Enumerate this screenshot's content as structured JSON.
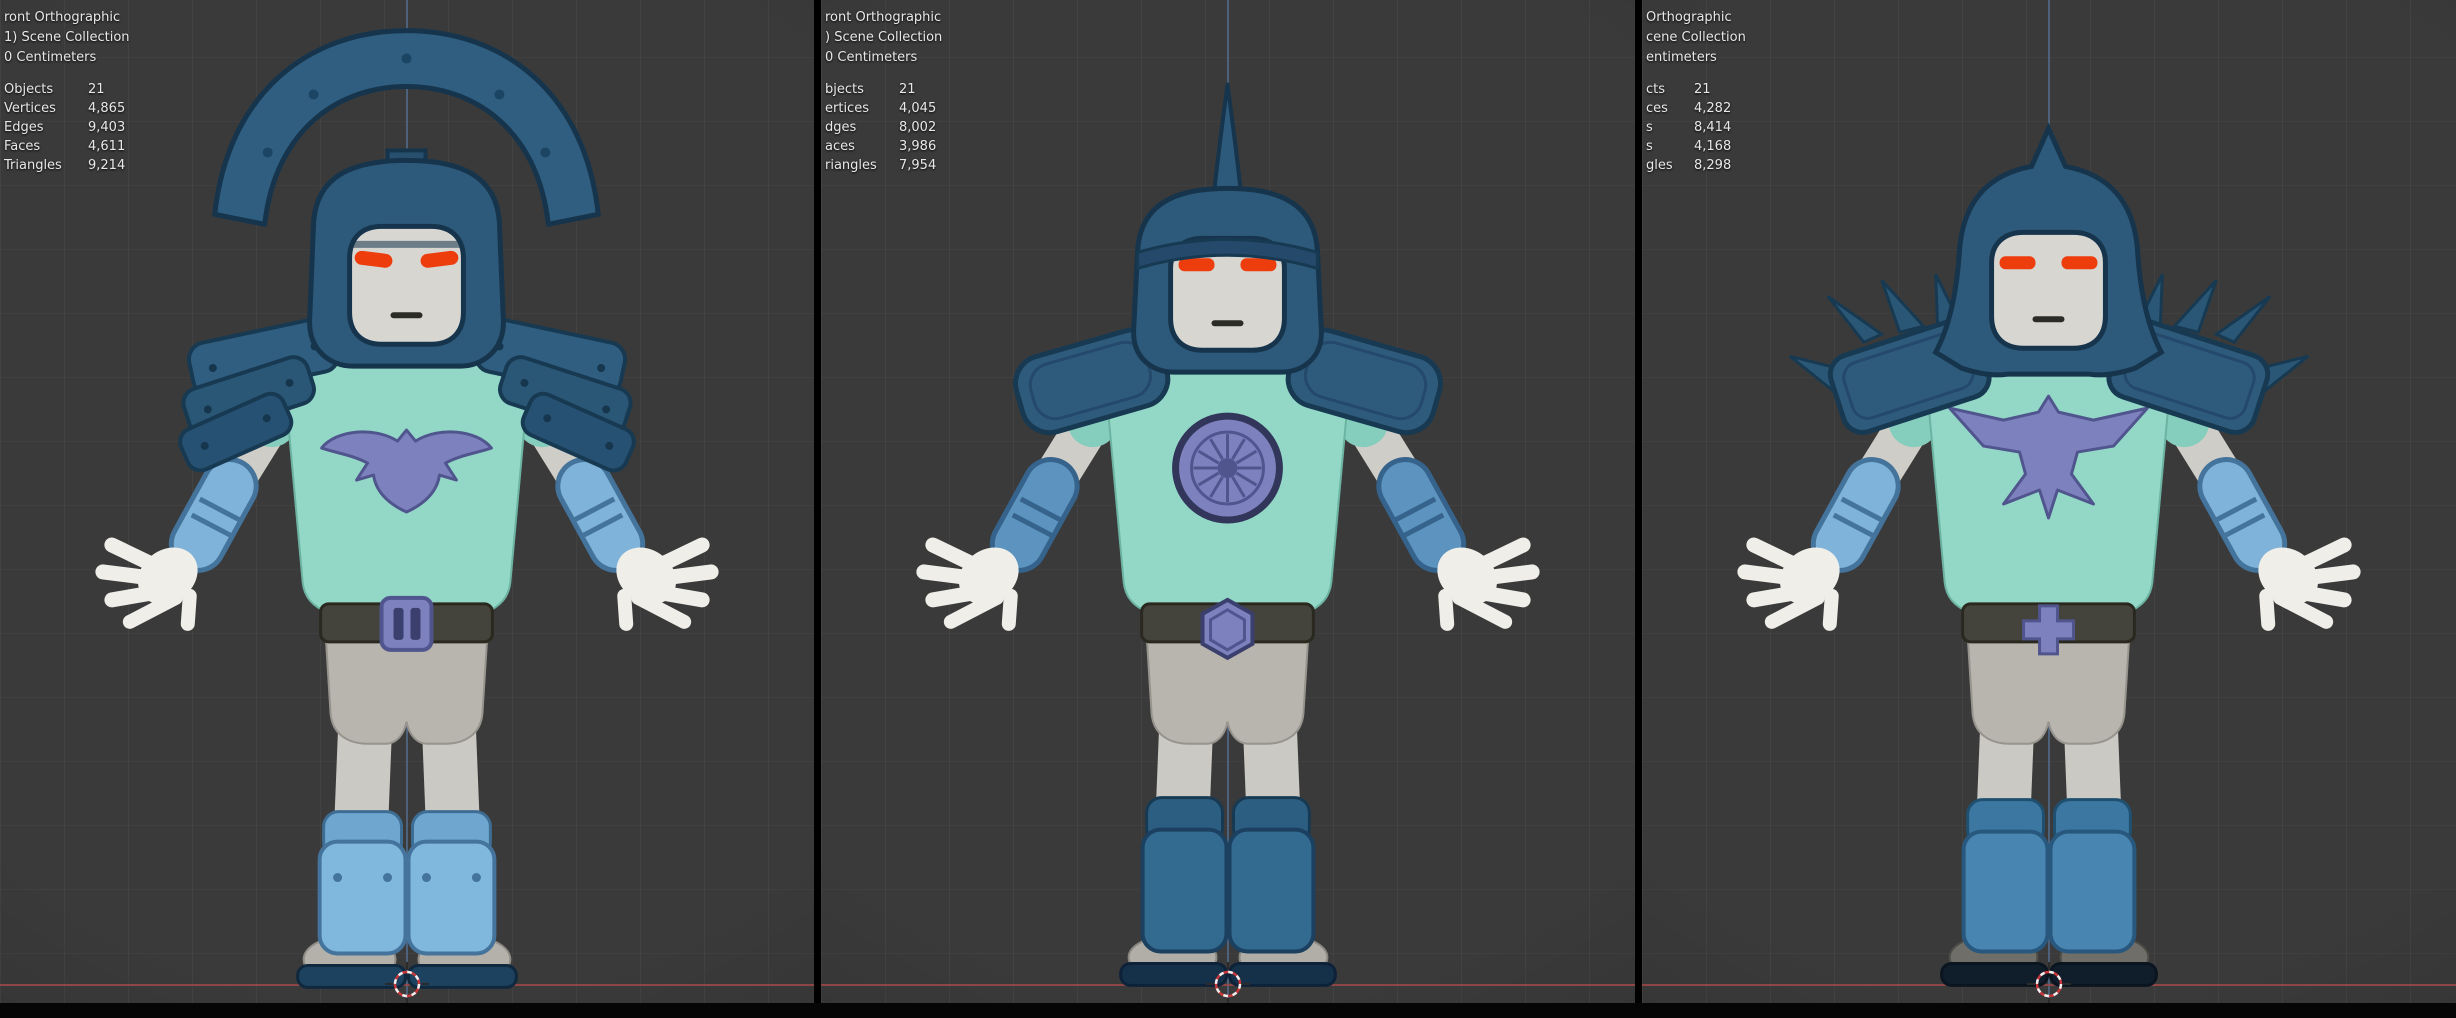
{
  "panels": [
    {
      "view_label": "ront Orthographic",
      "collection_label": "1) Scene Collection",
      "units_label": "0 Centimeters",
      "stats": [
        {
          "label": "Objects",
          "value": "21"
        },
        {
          "label": "Vertices",
          "value": "4,865"
        },
        {
          "label": "Edges",
          "value": "9,403"
        },
        {
          "label": "Faces",
          "value": "4,611"
        },
        {
          "label": "Triangles",
          "value": "9,214"
        }
      ]
    },
    {
      "view_label": "ront Orthographic",
      "collection_label": ") Scene Collection",
      "units_label": "0 Centimeters",
      "stats": [
        {
          "label": "bjects",
          "value": "21"
        },
        {
          "label": "ertices",
          "value": "4,045"
        },
        {
          "label": "dges",
          "value": "8,002"
        },
        {
          "label": "aces",
          "value": "3,986"
        },
        {
          "label": "riangles",
          "value": "7,954"
        }
      ]
    },
    {
      "view_label": "Orthographic",
      "collection_label": "cene Collection",
      "units_label": "entimeters",
      "stats": [
        {
          "label": "cts",
          "value": "21"
        },
        {
          "label": "ces",
          "value": "4,282"
        },
        {
          "label": "s",
          "value": "8,414"
        },
        {
          "label": "s",
          "value": "4,168"
        },
        {
          "label": "gles",
          "value": "8,298"
        }
      ]
    }
  ],
  "colors": {
    "viewport_bg": "#3a3a3a",
    "armor_dark_blue": "#2d5a7b",
    "armor_light_blue": "#80b7dc",
    "armor_medium_blue": "#5d93bf",
    "shirt_teal": "#93d8c7",
    "emblem_purple": "#7d82bf",
    "eyes_red": "#ee3d0c",
    "skin_grey": "#d8d6d1",
    "belt_dark": "#45443c",
    "floor_line_red": "#9e4848",
    "axis_line_blue": "#5f82af"
  }
}
